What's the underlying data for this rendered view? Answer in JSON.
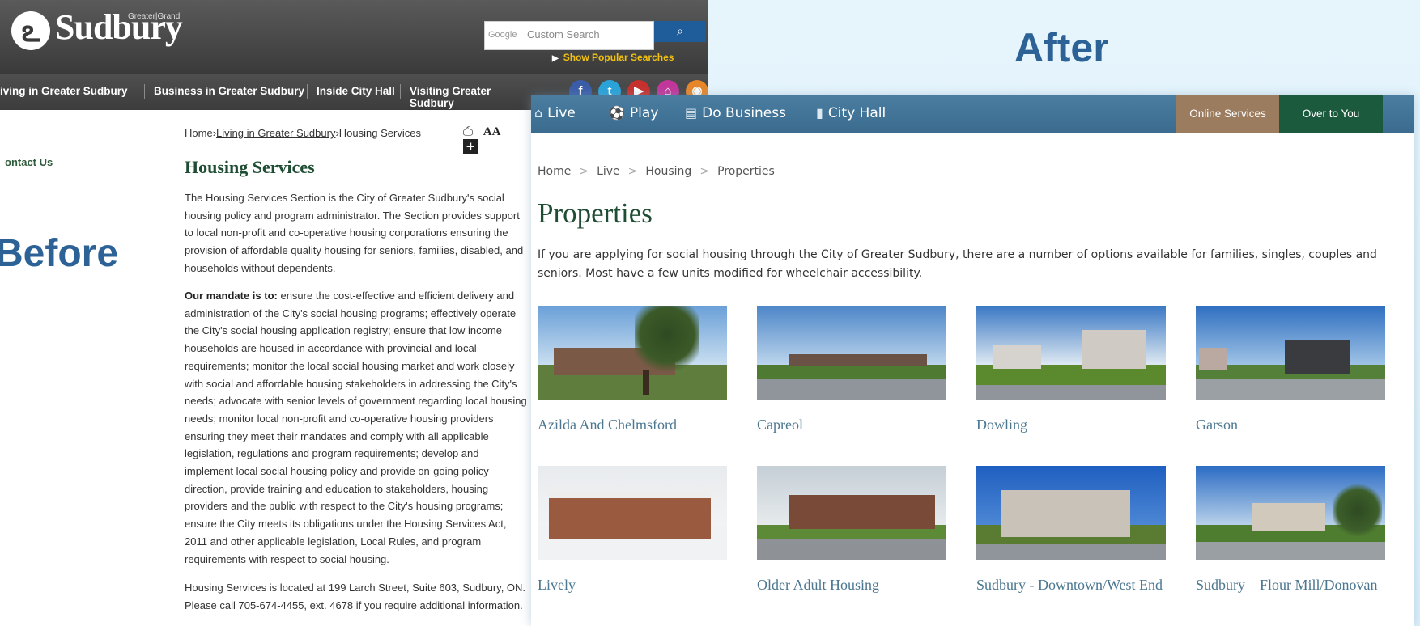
{
  "labels": {
    "after": "After",
    "before": "Before"
  },
  "before": {
    "logo": {
      "sup": "Greater|Grand",
      "text": "Sudbury"
    },
    "search": {
      "provider": "Google",
      "placeholder": "Custom Search",
      "button_icon": "magnifier"
    },
    "popular_link": "Show Popular Searches",
    "nav": [
      "iving in Greater Sudbury",
      "Business in Greater Sudbury",
      "Inside City Hall",
      "Visiting Greater Sudbury"
    ],
    "social": [
      "f",
      "t",
      "▶",
      "⌂",
      "◉"
    ],
    "breadcrumb": {
      "home": "Home",
      "sep": "›",
      "living": "Living in Greater Sudbury",
      "current": "Housing Services"
    },
    "tools": {
      "print": "⎙",
      "text_size": "AA",
      "add": "+"
    },
    "sidebar_contact": "ontact Us",
    "title": "Housing Services",
    "p1": "The Housing Services Section is the City of Greater Sudbury's social housing policy and program administrator. The Section provides support to local non-profit and co-operative housing corporations ensuring the provision of affordable quality housing for seniors, families,  disabled, and households without dependents.",
    "p2_lead": "Our mandate is to:",
    "p2_rest": " ensure the cost-effective and efficient delivery and administration of the City's social housing programs; effectively operate the City's social housing application registry; ensure that low income households are housed in accordance with provincial and local requirements; monitor the local social housing market and work closely with social and affordable housing stakeholders in addressing the City's needs; advocate with senior levels of government regarding local housing needs; monitor local non-profit and co-operative housing providers ensuring they meet their mandates and comply with all applicable legislation, regulations and program requirements; develop and implement local social housing policy and provide on-going policy direction, provide training and education to stakeholders, housing providers and the public with respect to the City's housing programs; ensure the City meets its obligations under the Housing Services Act, 2011 and other applicable legislation, Local Rules, and program requirements with respect to social housing.",
    "p3": "Housing Services is located at 199 Larch Street, Suite 603, Sudbury, ON.  Please call 705-674-4455, ext. 4678 if you require additional information."
  },
  "after": {
    "nav": [
      {
        "icon": "home-icon",
        "glyph": "⌂",
        "label": "Live"
      },
      {
        "icon": "play-icon",
        "glyph": "⚽",
        "label": "Play"
      },
      {
        "icon": "business-icon",
        "glyph": "▤",
        "label": "Do Business"
      },
      {
        "icon": "city-hall-icon",
        "glyph": "▮",
        "label": "City Hall"
      }
    ],
    "online_services": "Online Services",
    "over_to_you": "Over to You",
    "breadcrumb": [
      "Home",
      "Live",
      "Housing",
      "Properties"
    ],
    "breadcrumb_sep": ">",
    "title": "Properties",
    "intro": "If you are applying for social housing through the City of Greater Sudbury, there are a number of options available for families, singles, couples and seniors. Most have a few units modified for wheelchair accessibility.",
    "properties": [
      {
        "label": "Azilda And Chelmsford"
      },
      {
        "label": "Capreol"
      },
      {
        "label": "Dowling"
      },
      {
        "label": "Garson"
      },
      {
        "label": "Lively"
      },
      {
        "label": "Older Adult Housing"
      },
      {
        "label": "Sudbury - Downtown/West End"
      },
      {
        "label": "Sudbury – Flour Mill/Donovan"
      }
    ]
  },
  "colors": {
    "page_bg": "#e2f2fb",
    "label_blue": "#2c6296",
    "before_header": "#444444",
    "popular_yellow": "#f2c10f",
    "after_nav": "#3f7092",
    "online_services_bg": "#9b7c5f",
    "over_to_you_bg": "#1c5a3e",
    "title_green": "#1f4d33",
    "property_label": "#4b7790"
  }
}
